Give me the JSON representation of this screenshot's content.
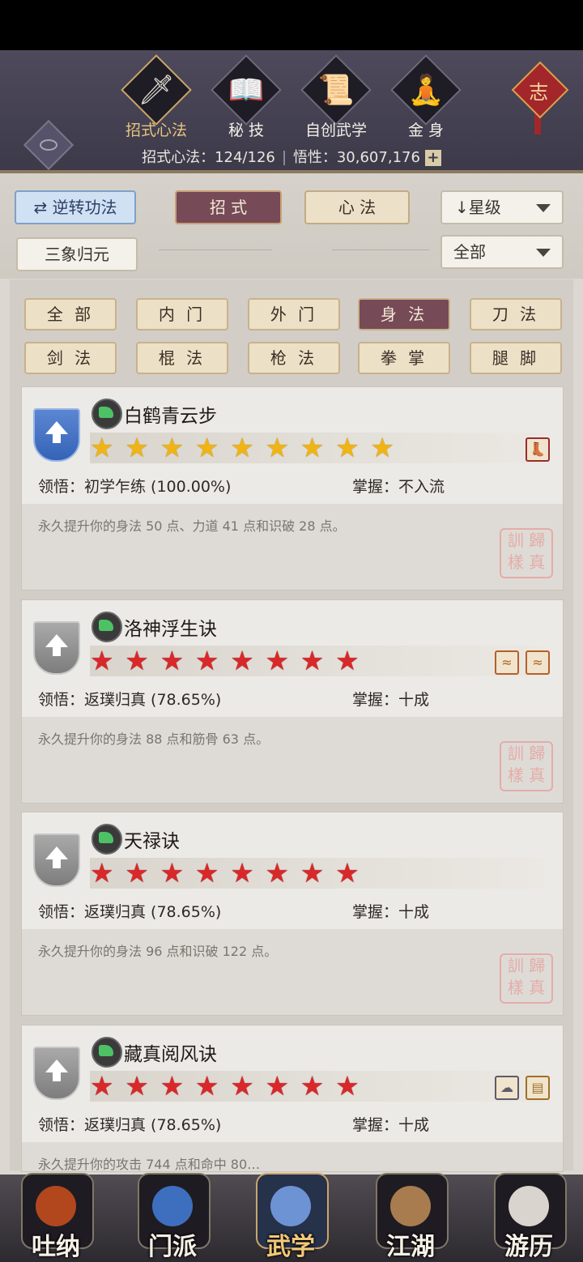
{
  "top_nav": [
    {
      "label": "招式心法",
      "icon": "sword-icon",
      "active": true
    },
    {
      "label": "秘 技",
      "icon": "book-icon",
      "active": false
    },
    {
      "label": "自创武学",
      "icon": "scroll-icon",
      "active": false
    },
    {
      "label": "金 身",
      "icon": "meditation-icon",
      "active": false
    }
  ],
  "knot_char": "志",
  "stats": {
    "techniques": "招式心法：124/126",
    "comprehension": "悟性：30,607,176",
    "plus": "+"
  },
  "controls": {
    "reverse": "逆转功法",
    "move": "招 式",
    "mind": "心 法",
    "sort": "星级",
    "sort_icon": "↓",
    "three": "三象归元",
    "filter_all": "全部"
  },
  "filters": [
    "全 部",
    "内 门",
    "外 门",
    "身 法",
    "刀 法",
    "剑 法",
    "棍 法",
    "枪 法",
    "拳 掌",
    "腿 脚"
  ],
  "active_filter_index": 3,
  "cards": [
    {
      "title": "白鹤青云步",
      "stars": 9,
      "star_color": "gold",
      "shield": "blue",
      "comprehension": "领悟：初学乍练 (100.00%)",
      "mastery": "掌握：不入流",
      "description": "永久提升你的身法 50 点、力道 41 点和识破 28 点。",
      "tags": [
        "boot-tag-icon"
      ],
      "seal": "訓 歸\n樣 真"
    },
    {
      "title": "洛神浮生诀",
      "stars": 8,
      "star_color": "red",
      "shield": "gray",
      "comprehension": "领悟：返璞归真 (78.65%)",
      "mastery": "掌握：十成",
      "description": "永久提升你的身法 88 点和筋骨 63 点。",
      "tags": [
        "wave-tag-icon",
        "wave-tag-icon"
      ],
      "seal": "訓 歸\n樣 真"
    },
    {
      "title": "天禄诀",
      "stars": 8,
      "star_color": "red",
      "shield": "gray",
      "comprehension": "领悟：返璞归真 (78.65%)",
      "mastery": "掌握：十成",
      "description": "永久提升你的身法 96 点和识破 122 点。",
      "tags": [],
      "seal": "訓 歸\n樣 真"
    },
    {
      "title": "藏真阅风诀",
      "stars": 8,
      "star_color": "red",
      "shield": "gray",
      "comprehension": "领悟：返璞归真 (78.65%)",
      "mastery": "掌握：十成",
      "description": "永久提升你的攻击 744 点和命中 80…",
      "tags": [
        "cloud-tag-icon",
        "scroll-tag-icon"
      ],
      "seal": ""
    }
  ],
  "bottom_nav": [
    {
      "label": "吐纳",
      "active": false,
      "color": "#b2471e"
    },
    {
      "label": "门派",
      "active": false,
      "color": "#3e6fbf"
    },
    {
      "label": "武学",
      "active": true,
      "color": "#6e93d4"
    },
    {
      "label": "江湖",
      "active": false,
      "color": "#a87c4f"
    },
    {
      "label": "游历",
      "active": false,
      "color": "#d9d4ce"
    }
  ]
}
